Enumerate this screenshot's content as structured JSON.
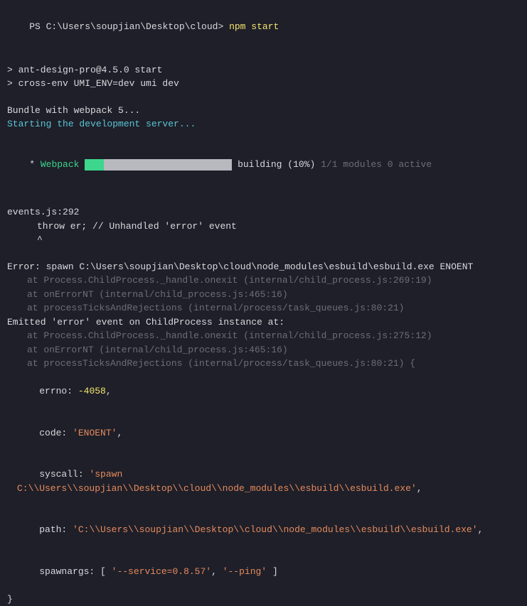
{
  "prompt": {
    "prefix": "PS ",
    "path": "C:\\Users\\soupjian\\Desktop\\cloud>",
    "command": "npm start"
  },
  "scriptOutput": {
    "line1": "> ant-design-pro@4.5.0 start",
    "line2": "> cross-env UMI_ENV=dev umi dev"
  },
  "bundle": {
    "line1": "Bundle with webpack 5...",
    "line2": "Starting the development server..."
  },
  "webpack": {
    "star": "*",
    "label": "Webpack",
    "buildingText": "building (10%)",
    "modulesText": "1/1 modules 0 active"
  },
  "events": {
    "file": "events.js:292",
    "throwLine": "throw er; // Unhandled 'error' event",
    "caret": "^"
  },
  "error": {
    "header": "Error: spawn C:\\Users\\soupjian\\Desktop\\cloud\\node_modules\\esbuild\\esbuild.exe ENOENT",
    "stack1": "at Process.ChildProcess._handle.onexit (internal/child_process.js:269:19)",
    "stack2": "at onErrorNT (internal/child_process.js:465:16)",
    "stack3": "at processTicksAndRejections (internal/process/task_queues.js:80:21)",
    "emitted": "Emitted 'error' event on ChildProcess instance at:",
    "stack4": "at Process.ChildProcess._handle.onexit (internal/child_process.js:275:12)",
    "stack5": "at onErrorNT (internal/child_process.js:465:16)",
    "stack6": "at processTicksAndRejections (internal/process/task_queues.js:80:21) {",
    "errnoLabel": "errno:",
    "errnoVal": "-4058",
    "codeLabel": "code:",
    "codeVal": "'ENOENT'",
    "syscallLabel": "syscall:",
    "syscallVal": "'spawn C:\\\\Users\\\\soupjian\\\\Desktop\\\\cloud\\\\node_modules\\\\esbuild\\\\esbuild.exe'",
    "pathLabel": "path:",
    "pathVal": "'C:\\\\Users\\\\soupjian\\\\Desktop\\\\cloud\\\\node_modules\\\\esbuild\\\\esbuild.exe'",
    "spawnargsLabel": "spawnargs: [",
    "spawnarg1": "'--service=0.8.57'",
    "spawnarg2": "'--ping'",
    "spawnargsClose": "]",
    "closeBrace": "}",
    "comma": ","
  }
}
